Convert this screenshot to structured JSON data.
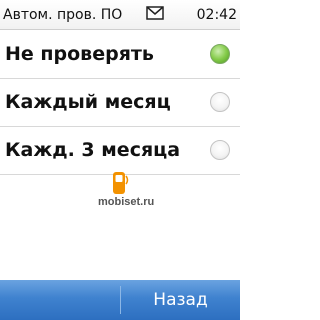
{
  "status_bar": {
    "title": "Автом. пров. ПО",
    "time": "02:42",
    "message_icon": "envelope-icon"
  },
  "options": [
    {
      "label": "Не проверять",
      "selected": true
    },
    {
      "label": "Каждый месяц",
      "selected": false
    },
    {
      "label": "Кажд. 3 месяца",
      "selected": false
    }
  ],
  "watermark": {
    "text": "mobiset.ru",
    "icon": "phone-logo"
  },
  "softkeys": {
    "right_label": "Назад"
  },
  "colors": {
    "softkey_bar": "#3f82cf",
    "radio_selected": "#86cc4c",
    "watermark_logo": "#f39200"
  }
}
